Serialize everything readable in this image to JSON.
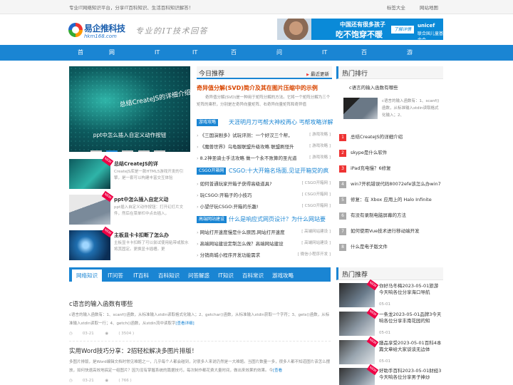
{
  "topbar": {
    "slogan": "专业IT网络知识平台，分享IT百科知识、生活百科知识解答！",
    "links": [
      "标签大全",
      "网站地图"
    ]
  },
  "logo": {
    "name": "易企推科技",
    "domain": "hkm168.com"
  },
  "motto": "专业的IT技术回答",
  "banner": {
    "line1": "中国还有很多孩子",
    "line2": "吃不饱穿不暖",
    "button": "了解详情",
    "brand": "unicef",
    "brand_sub": "联合国儿童基金会"
  },
  "nav": [
    "首页",
    "网络知识",
    "IT百科",
    "IT问答",
    "百科知识",
    "问答解惑",
    "IT知识",
    "百科常识",
    "游戏攻略"
  ],
  "hero": {
    "image_title": "总结CreateJS的详细介绍",
    "caption": "ppt中怎么插入自定义动作按钮"
  },
  "side_items": [
    {
      "title": "总结CreateJS的详",
      "desc": "CreateJS库是一款HTML5游戏开发的引擎，是一套可以构建丰富交互体验",
      "tag": "NEW"
    },
    {
      "title": "ppt中怎么插入自定义动",
      "desc": "ppt插入自定义动作按钮：打开幻灯片文件，然后在菜单栏中点击插入，",
      "tag": "NEW"
    },
    {
      "title": "主板显卡卡扣断了怎么办",
      "desc": "主板显卡卡扣断了可以尝试使用粘带或胶水将其固定。更换显卡插槽。更",
      "tag": "NEW"
    }
  ],
  "recommend": {
    "title": "今日推荐",
    "latest": "最近更新",
    "lead_title": "奇异值分解(SVD)简介及其在图片压缩中的示例",
    "lead_desc": "奇异值分解(SVD)是一种用于矩阵分解的方法。它将一个矩阵分解为三个矩阵的乘积，分别是左奇异向量矩阵、右奇异向量矩阵和奇异值",
    "sections": [
      {
        "label": "游戏攻略",
        "headline": "天涯明月刀丐帮大神校再心 丐帮攻略详解",
        "items": [
          {
            "text": "《三国演剧多》试玩评测：一个好汉三个帮，",
            "cat": "[ 游戏攻略 ]"
          },
          {
            "text": "《魔兽世界》乌龟服联盟升级攻略 联盟刷怪升",
            "cat": "[ 游戏攻略 ]"
          },
          {
            "text": "8.2神圣骑士手法攻略 做一个永不败算的圣光道",
            "cat": "[ 游戏攻略 ]"
          }
        ]
      },
      {
        "label": "CSGO开箱网",
        "headline": "CSGO:十大开箱名场面,见证开箱党的疯",
        "items": [
          {
            "text": "如何普通玩家开箱子获得高级道具?",
            "cat": "[ CSGO开箱网 ]"
          },
          {
            "text": "玩CSGO:开箱子的小技巧",
            "cat": "[ CSGO开箱网 ]"
          },
          {
            "text": "小望仔玩CSGO:开箱的乐趣!",
            "cat": "[ CSGO开箱网 ]"
          }
        ]
      },
      {
        "label": "高端网站建设",
        "headline": "什么是响应式网页设计？为什么网站要",
        "items": [
          {
            "text": "网站打开速度慢是什么原因,网站打开速度",
            "cat": "[ 高端网站建设 ]"
          },
          {
            "text": "高端网站建设定制怎么做？高端网站建设",
            "cat": "[ 高端网站建设 ]"
          },
          {
            "text": "分销商城小程序开发功能需求",
            "cat": "[ 微信小程序开发 ]"
          }
        ]
      }
    ]
  },
  "hot_rank": {
    "title": "热门排行",
    "first": {
      "title": "c语言的输入函数有哪些",
      "desc": "c语言的输入函数有：1、scanf()函数，从标准输入stdin读取格式化输入；2、"
    },
    "items": [
      {
        "n": "1",
        "text": "总结CreateJS的详细介绍",
        "hot": true
      },
      {
        "n": "2",
        "text": "skype是什么软件",
        "hot": true
      },
      {
        "n": "3",
        "text": "iPad充电慢？6修复",
        "hot": true
      },
      {
        "n": "4",
        "text": "win7开机错误代码80072efe该怎么办win7",
        "hot": false
      },
      {
        "n": "5",
        "text": "修复：在 Xbox 应用上的 Halo Infinite",
        "hot": false
      },
      {
        "n": "6",
        "text": "有没有录制电脑屏幕的方法",
        "hot": false
      },
      {
        "n": "7",
        "text": "如何使用Vue技术进行移动端开发",
        "hot": false
      },
      {
        "n": "8",
        "text": "什么是电子版文件",
        "hot": false
      }
    ]
  },
  "hot_recommend": {
    "title": "热门推荐",
    "items": [
      {
        "title": "你好马冬梅2023-05-01旅游今天响各位分享海口导航",
        "date": "05-01",
        "tag": "NEW"
      },
      {
        "title": "一条龙2023-05-01品牌3今天响各位分享丰南花园的知",
        "date": "05-01",
        "tag": "NEW"
      },
      {
        "title": "膳品享受2023-05-01百科4本篇文章给大家谈谈无边体",
        "date": "05-01",
        "tag": "NEW"
      },
      {
        "title": "好助手百科2023-05-01财经3今天响各位分享男子捧炒",
        "date": "05-01",
        "tag": "NEW"
      }
    ]
  },
  "tabs": [
    "网络知识",
    "IT问答",
    "IT百科",
    "百科知识",
    "问答解惑",
    "IT知识",
    "百科常识",
    "游戏攻略"
  ],
  "articles": [
    {
      "title": "c语言的输入函数有哪些",
      "desc": "c语言的输入函数有：1、scanf()函数，从标准输入stdin读取格式化输入；2、getchar()函数，从标准输入stdin获取一个字符；3、gets()函数，从标准输入stdin读取一行；4、getch()函数，从stdin流中读取字",
      "more": "[查看详细]",
      "date": "03-21",
      "views": "( 3504 )"
    },
    {
      "title": "实用Word技巧分享：2招轻松解决多图片排版！",
      "desc": "多图片排版，是Word编辑文档时常见难题之一，几乎每个人都会碰到，对很多人来说仍然是一大难题。当图片数量一多，很多人都不知道图片该怎么摆放，如何快速高效地搞定一组图片？因为没有掌握系统的篇据技巧，每次制作都花费大量时间，做出来效果的效果。今",
      "more": "[查看",
      "date": "03-21",
      "views": "( 766 )"
    }
  ],
  "colors": {
    "accent": "#1a85d3",
    "hot": "#e33333",
    "lead": "#d94600"
  }
}
